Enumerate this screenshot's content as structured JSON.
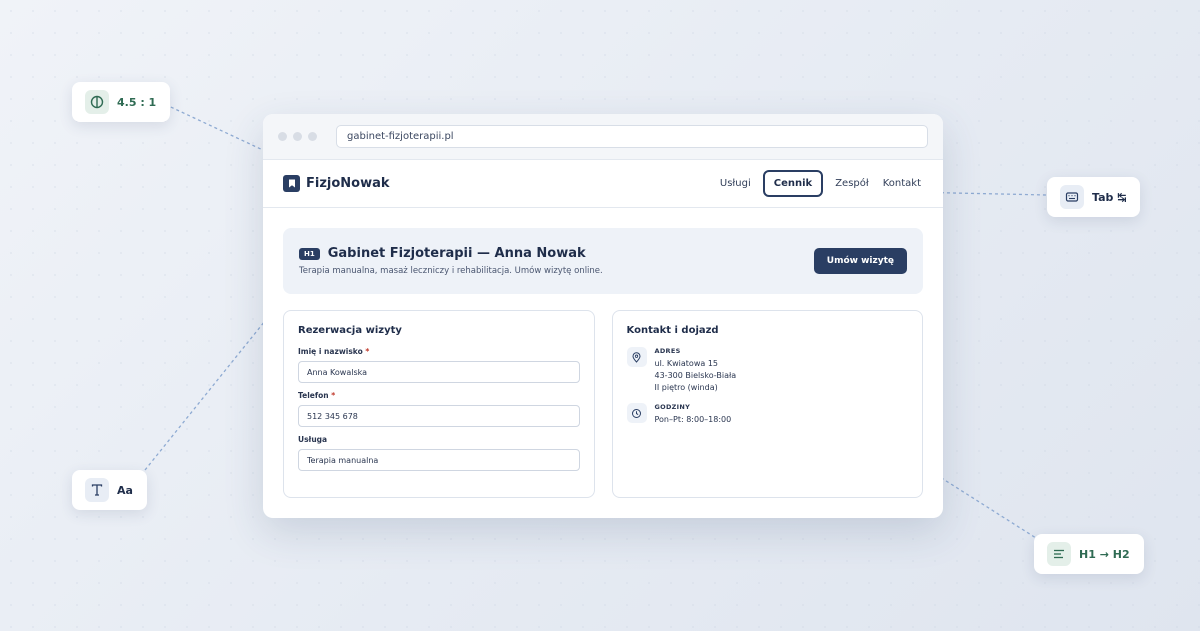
{
  "badges": {
    "contrast": {
      "text": "4.5 : 1",
      "icon": "contrast-icon"
    },
    "keyboard": {
      "text": "Tab ↹",
      "icon": "keyboard-icon"
    },
    "font": {
      "text": "Aa",
      "icon": "text-icon"
    },
    "heading": {
      "text": "H1 → H2",
      "icon": "heading-icon"
    }
  },
  "browser": {
    "url": "gabinet-fizjoterapii.pl"
  },
  "site": {
    "logo": "FizjoNowak",
    "nav": [
      "Usługi",
      "Cennik",
      "Zespół",
      "Kontakt"
    ],
    "nav_active": "Cennik"
  },
  "hero": {
    "tag": "H1",
    "title": "Gabinet Fizjoterapii — Anna Nowak",
    "subtitle": "Terapia manualna, masaż leczniczy i rehabilitacja. Umów wizytę online.",
    "cta": "Umów wizytę"
  },
  "booking": {
    "title": "Rezerwacja wizyty",
    "fields": [
      {
        "label": "Imię i nazwisko",
        "required": "*",
        "value": "Anna Kowalska"
      },
      {
        "label": "Telefon",
        "required": "*",
        "value": "512 345 678"
      },
      {
        "label": "Usługa",
        "required": "",
        "value": "Terapia manualna"
      }
    ]
  },
  "contact": {
    "title": "Kontakt i dojazd",
    "address": {
      "label": "ADRES",
      "lines": [
        "ul. Kwiatowa 15",
        "43-300 Bielsko-Biała",
        "II piętro (winda)"
      ]
    },
    "hours": {
      "label": "GODZINY",
      "lines": [
        "Pon–Pt: 8:00–18:00"
      ]
    }
  },
  "colors": {
    "primary": "#2a3e63",
    "accent_green": "#2f6b53",
    "connector": "#8eaad2",
    "required": "#c0392b"
  }
}
